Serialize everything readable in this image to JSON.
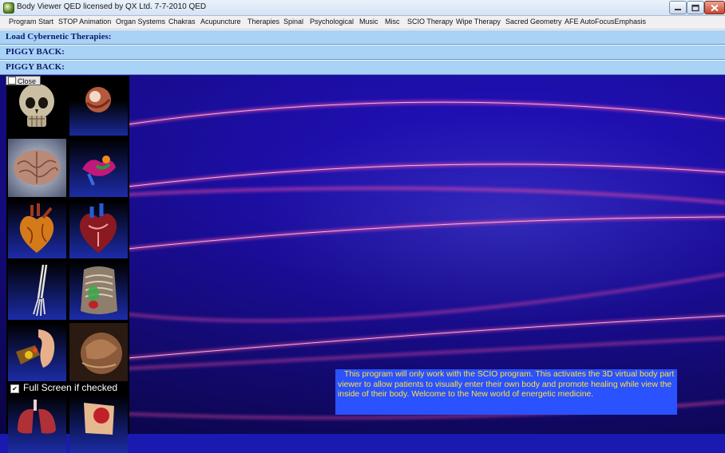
{
  "window": {
    "title": "Body Viewer QED  licensed by QX Ltd.  7-7-2010 QED",
    "controls": [
      "minimize-icon",
      "maximize-icon",
      "close-icon"
    ]
  },
  "menu": {
    "items": [
      "Program Start",
      "STOP Animation",
      "Organ Systems",
      "Chakras",
      "Acupuncture",
      "Therapies",
      "Spinal",
      "Psychological",
      "Music",
      "Misc",
      "SCIO Therapy",
      "Wipe Therapy",
      "Sacred Geometry",
      "AFE AutoFocusEmphasis"
    ]
  },
  "panels": {
    "load_therapies": "Load Cybernetic Therapies:",
    "piggy_back_1": "PIGGY BACK:",
    "piggy_back_2": "PIGGY BACK:"
  },
  "close_button": {
    "label": "Close",
    "icon": "window-icon"
  },
  "thumbnails": [
    {
      "icon": "skull-icon"
    },
    {
      "icon": "eye-icon"
    },
    {
      "icon": "brain-icon"
    },
    {
      "icon": "pancreas-icon"
    },
    {
      "icon": "heart-icon"
    },
    {
      "icon": "heart-cross-section-icon"
    },
    {
      "icon": "arm-bones-icon"
    },
    {
      "icon": "torso-ribcage-icon"
    },
    {
      "icon": "ear-icon"
    },
    {
      "icon": "tissue-icon"
    },
    {
      "icon": "lungs-icon"
    },
    {
      "icon": "organ-slice-icon"
    }
  ],
  "fullscreen_option": {
    "label": "Full Screen if checked",
    "checked": true
  },
  "info": {
    "text": "This program will only work with the SCIO program. This activates the 3D virtual body  part viewer to allow patients to visually enter their own body and promote healing while view the inside of their body. Welcome to the New world of  energetic medicine."
  },
  "colors": {
    "background": "#1a1ab0",
    "panel_blue": "#a9d3f6",
    "info_box": "#2a52ff",
    "info_text": "#ffe23a",
    "streak": "#ff4fa8"
  }
}
